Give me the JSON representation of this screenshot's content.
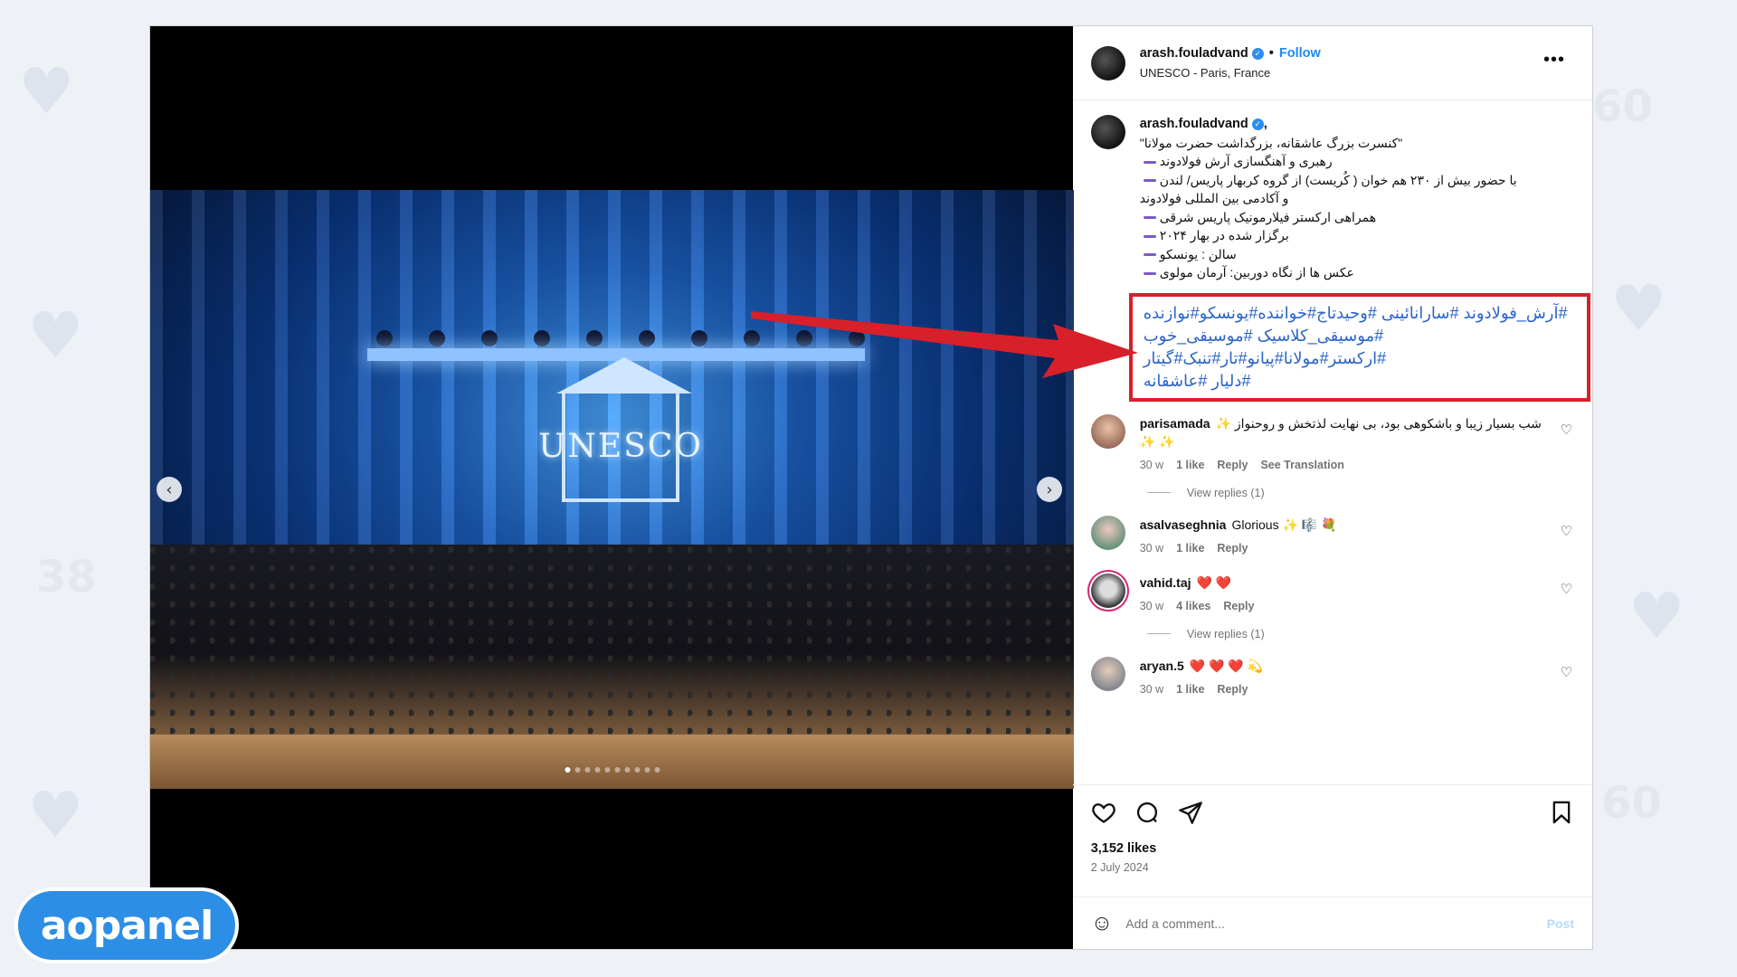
{
  "post": {
    "username": "arash.fouladvand",
    "follow_label": "Follow",
    "location": "UNESCO - Paris, France",
    "more_label": "•••",
    "separator": "•"
  },
  "caption": {
    "username": "arash.fouladvand",
    "suffix": " ,",
    "lines": [
      "\"کنسرت بزرگ عاشقانه، بزرگداشت حضرت مولانا\"",
      "رهبری و آهنگسازی آرش فولادوند",
      "با حضور بیش از ۲۳۰ هم خوان ( کُریست) از گروه کربهار پاریس/ لندن",
      "و آکادمی بین المللی فولادوند",
      "همراهی ارکستر فیلارمونیک پاریس شرقی",
      "برگزار شده در بهار ۲۰۲۴",
      "سالن : یونسکو",
      "عکس ها از نگاه دوربین: آرمان مولوی"
    ],
    "hashtags": [
      "#آرش_فولادوند #سارانائینی #وحیدتاج#خواننده#یونسکو#نوازنده",
      "#موسیقی_کلاسیک #موسیقی_خوب",
      "#ارکستر#مولانا#پیانو#تار#تنبک#گیتار",
      "#دلیار #عاشقانه"
    ]
  },
  "comments": [
    {
      "username": "parisamada",
      "text": "شب بسیار زیبا و باشکوهی بود، بی نهایت لذتخش و روحنواز ✨ ✨ ✨",
      "time": "30 w",
      "likes": "1 like",
      "reply": "Reply",
      "translate": "See Translation",
      "view_replies": "View replies (1)"
    },
    {
      "username": "asalvaseghnia",
      "text": "Glorious ✨ 🎼 💐",
      "time": "30 w",
      "likes": "1 like",
      "reply": "Reply"
    },
    {
      "username": "vahid.taj",
      "text": "❤️ ❤️",
      "time": "30 w",
      "likes": "4 likes",
      "reply": "Reply",
      "view_replies": "View replies (1)"
    },
    {
      "username": "aryan.5",
      "text": "❤️ ❤️ ❤️ 💫",
      "time": "30 w",
      "likes": "1 like",
      "reply": "Reply"
    }
  ],
  "stats": {
    "likes": "3,152 likes",
    "date": "2 July 2024"
  },
  "add_comment": {
    "placeholder": "Add a comment...",
    "post_label": "Post"
  },
  "photo": {
    "logo_text": "UNESCO"
  },
  "nav": {
    "prev": "‹",
    "next": "›"
  },
  "watermark": {
    "text": "aopanel"
  },
  "colors": {
    "highlight_box": "#d7202a",
    "hashtag": "#2b64c8",
    "follow": "#1a8cf0",
    "arrow": "#d7202a"
  },
  "icons": [
    "heart-icon",
    "comment-icon",
    "share-icon",
    "bookmark-icon",
    "emoji-icon",
    "verified-icon",
    "more-icon"
  ]
}
